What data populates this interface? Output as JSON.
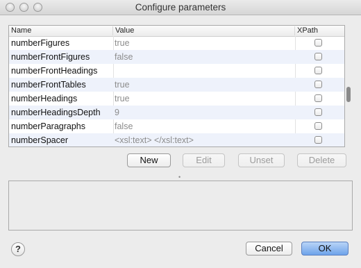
{
  "window": {
    "title": "Configure parameters"
  },
  "table": {
    "columns": [
      "Name",
      "Value",
      "XPath"
    ],
    "rows": [
      {
        "name": "numberFigures",
        "value": "true"
      },
      {
        "name": "numberFrontFigures",
        "value": "false"
      },
      {
        "name": "numberFrontHeadings",
        "value": ""
      },
      {
        "name": "numberFrontTables",
        "value": "true"
      },
      {
        "name": "numberHeadings",
        "value": "true"
      },
      {
        "name": "numberHeadingsDepth",
        "value": "9"
      },
      {
        "name": "numberParagraphs",
        "value": "false"
      },
      {
        "name": "numberSpacer",
        "value": "<xsl:text> </xsl:text>"
      }
    ]
  },
  "actions": {
    "new": "New",
    "edit": "Edit",
    "unset": "Unset",
    "delete": "Delete"
  },
  "footer": {
    "help": "?",
    "cancel": "Cancel",
    "ok": "OK"
  }
}
